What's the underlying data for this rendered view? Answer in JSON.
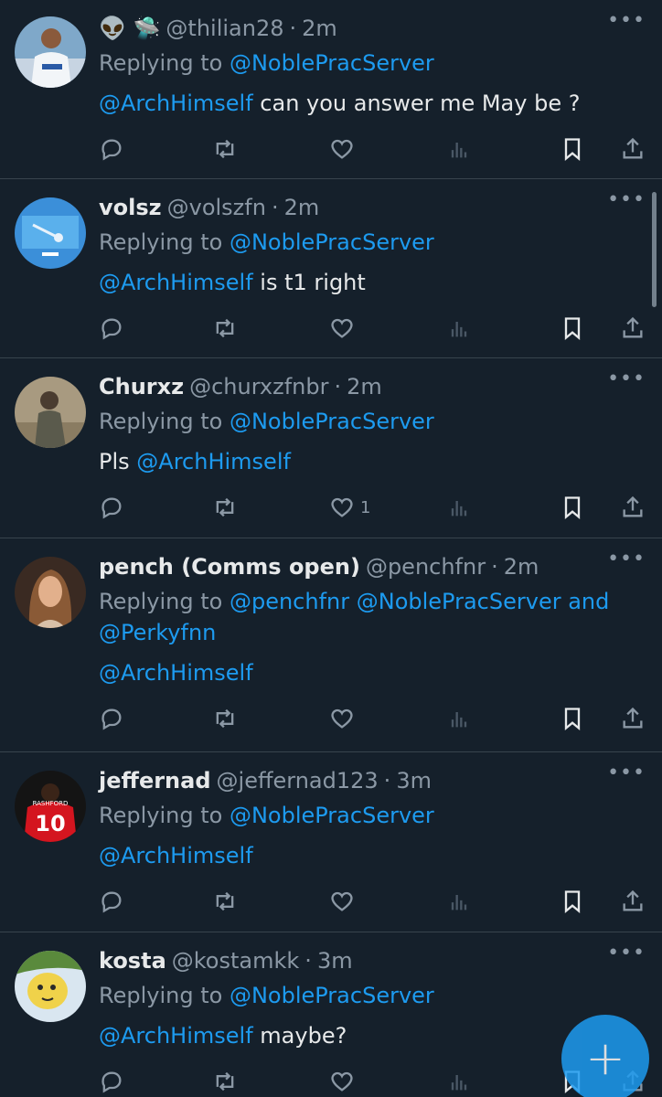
{
  "feed": {
    "more_label": "•••",
    "replying_label": "Replying to",
    "tweets": [
      {
        "name": "",
        "emoji": "👽 🛸",
        "handle": "@thilian28",
        "sep": "·",
        "time": "2m",
        "replying_links": [
          "@NoblePracServer"
        ],
        "replying_joiner": "",
        "body_mention": "@ArchHimself",
        "body_text": "can you answer me May be ?",
        "likes": ""
      },
      {
        "name": "volsz",
        "emoji": "",
        "handle": "@volszfn",
        "sep": "·",
        "time": "2m",
        "replying_links": [
          "@NoblePracServer"
        ],
        "replying_joiner": "",
        "body_mention": "@ArchHimself",
        "body_text": "is t1 right",
        "likes": ""
      },
      {
        "name": "Churxz",
        "emoji": "",
        "handle": "@churxzfnbr",
        "sep": "·",
        "time": "2m",
        "replying_links": [
          "@NoblePracServer"
        ],
        "replying_joiner": "",
        "body_prefix": "Pls",
        "body_mention": "@ArchHimself",
        "body_text": "",
        "likes": "1"
      },
      {
        "name": "pench (Comms open)",
        "emoji": "",
        "handle": "@penchfnr",
        "sep": "·",
        "time": "2m",
        "replying_links": [
          "@penchfnr",
          "@NoblePracServer",
          "@Perkyfnn"
        ],
        "replying_joiner": "and",
        "body_mention": "@ArchHimself",
        "body_text": "",
        "likes": ""
      },
      {
        "name": "jeffernad",
        "emoji": "",
        "handle": "@jeffernad123",
        "sep": "·",
        "time": "3m",
        "replying_links": [
          "@NoblePracServer"
        ],
        "replying_joiner": "",
        "body_mention": "@ArchHimself",
        "body_text": "",
        "likes": "",
        "avatar_text": "10",
        "avatar_caption": "RASHFORD"
      },
      {
        "name": "kosta",
        "emoji": "",
        "handle": "@kostamkk",
        "sep": "·",
        "time": "3m",
        "replying_links": [
          "@NoblePracServer"
        ],
        "replying_joiner": "",
        "body_mention": "@ArchHimself",
        "body_text": "maybe?",
        "likes": ""
      }
    ]
  },
  "icons": {
    "reply": "reply-icon",
    "retweet": "retweet-icon",
    "like": "heart-icon",
    "views": "views-icon",
    "bookmark": "bookmark-icon",
    "share": "share-icon"
  },
  "compose": {
    "label": "+"
  },
  "colors": {
    "background": "#15202b",
    "accent": "#1d9bf0",
    "muted": "#8b98a5",
    "text": "#e7e9ea",
    "divider": "#38444d"
  }
}
